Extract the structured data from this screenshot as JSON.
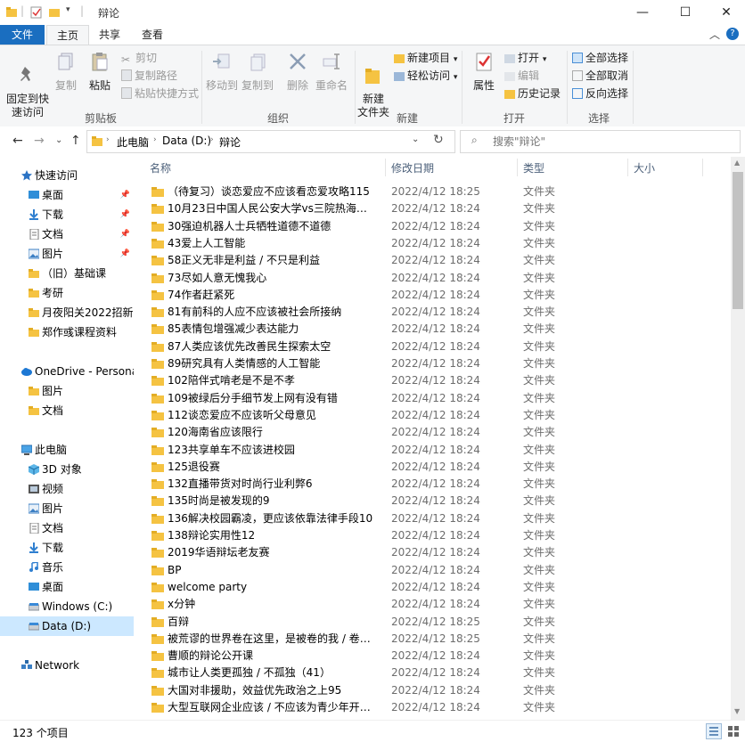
{
  "window": {
    "title": "辩论",
    "minimize": "—",
    "maximize": "☐",
    "close": "✕"
  },
  "tabs": [
    "文件",
    "主页",
    "共享",
    "查看"
  ],
  "ribbon": {
    "clipboard": {
      "pin_quick": "固定到快\n速访问",
      "copy": "复制",
      "paste": "粘贴",
      "cut": "剪切",
      "copy_path": "复制路径",
      "paste_shortcut": "粘贴快捷方式",
      "label": "剪贴板"
    },
    "organize": {
      "move_to": "移动到",
      "copy_to": "复制到",
      "delete": "删除",
      "rename": "重命名",
      "label": "组织"
    },
    "new": {
      "new_folder": "新建\n文件夹",
      "new_item": "新建项目",
      "easy_access": "轻松访问",
      "label": "新建"
    },
    "open": {
      "properties": "属性",
      "open": "打开",
      "edit": "编辑",
      "history": "历史记录",
      "label": "打开"
    },
    "select": {
      "select_all": "全部选择",
      "select_none": "全部取消",
      "invert": "反向选择",
      "label": "选择"
    }
  },
  "address": {
    "crumbs": [
      "此电脑",
      "Data (D:)",
      "辩论"
    ],
    "search_placeholder": "搜索\"辩论\""
  },
  "nav": [
    {
      "label": "快速访问",
      "icon": "star-icon",
      "indent": 0,
      "pin": false
    },
    {
      "label": "桌面",
      "icon": "desktop-icon",
      "indent": 1,
      "pin": true
    },
    {
      "label": "下载",
      "icon": "download-icon",
      "indent": 1,
      "pin": true
    },
    {
      "label": "文档",
      "icon": "document-icon",
      "indent": 1,
      "pin": true
    },
    {
      "label": "图片",
      "icon": "picture-icon",
      "indent": 1,
      "pin": true
    },
    {
      "label": "（旧）基础课",
      "icon": "folder-icon",
      "indent": 1,
      "pin": false
    },
    {
      "label": "考研",
      "icon": "folder-icon",
      "indent": 1,
      "pin": false
    },
    {
      "label": "月夜阳关2022招新",
      "icon": "folder-icon",
      "indent": 1,
      "pin": false
    },
    {
      "label": "郑作彧课程资料",
      "icon": "folder-icon",
      "indent": 1,
      "pin": false
    },
    {
      "label": "",
      "icon": "",
      "indent": 0,
      "pin": false
    },
    {
      "label": "OneDrive - Personal",
      "icon": "cloud-icon",
      "indent": 0,
      "pin": false
    },
    {
      "label": "图片",
      "icon": "folder-icon",
      "indent": 1,
      "pin": false
    },
    {
      "label": "文档",
      "icon": "folder-icon",
      "indent": 1,
      "pin": false
    },
    {
      "label": "",
      "icon": "",
      "indent": 0,
      "pin": false
    },
    {
      "label": "此电脑",
      "icon": "computer-icon",
      "indent": 0,
      "pin": false
    },
    {
      "label": "3D 对象",
      "icon": "cube-icon",
      "indent": 1,
      "pin": false
    },
    {
      "label": "视频",
      "icon": "video-icon",
      "indent": 1,
      "pin": false
    },
    {
      "label": "图片",
      "icon": "picture-icon",
      "indent": 1,
      "pin": false
    },
    {
      "label": "文档",
      "icon": "document-icon",
      "indent": 1,
      "pin": false
    },
    {
      "label": "下载",
      "icon": "download-icon",
      "indent": 1,
      "pin": false
    },
    {
      "label": "音乐",
      "icon": "music-icon",
      "indent": 1,
      "pin": false
    },
    {
      "label": "桌面",
      "icon": "desktop-icon",
      "indent": 1,
      "pin": false
    },
    {
      "label": "Windows (C:)",
      "icon": "drive-icon",
      "indent": 1,
      "pin": false
    },
    {
      "label": "Data (D:)",
      "icon": "drive-icon",
      "indent": 1,
      "pin": false,
      "selected": true
    },
    {
      "label": "",
      "icon": "",
      "indent": 0,
      "pin": false
    },
    {
      "label": "Network",
      "icon": "network-icon",
      "indent": 0,
      "pin": false
    }
  ],
  "columns": [
    "名称",
    "修改日期",
    "类型",
    "大小"
  ],
  "files": [
    {
      "name": "（待复习）谈恋爱应不应该看恋爱攻略115",
      "date": "2022/4/12 18:25",
      "type": "文件夹"
    },
    {
      "name": "10月23日中国人民公安大学vs三院热海联队",
      "date": "2022/4/12 18:24",
      "type": "文件夹"
    },
    {
      "name": "30强迫机器人士兵牺牲道德不道德",
      "date": "2022/4/12 18:24",
      "type": "文件夹"
    },
    {
      "name": "43爱上人工智能",
      "date": "2022/4/12 18:24",
      "type": "文件夹"
    },
    {
      "name": "58正义无非是利益 / 不只是利益",
      "date": "2022/4/12 18:24",
      "type": "文件夹"
    },
    {
      "name": "73尽如人意无愧我心",
      "date": "2022/4/12 18:24",
      "type": "文件夹"
    },
    {
      "name": "74作者赶紧死",
      "date": "2022/4/12 18:24",
      "type": "文件夹"
    },
    {
      "name": "81有前科的人应不应该被社会所接纳",
      "date": "2022/4/12 18:24",
      "type": "文件夹"
    },
    {
      "name": "85表情包增强减少表达能力",
      "date": "2022/4/12 18:24",
      "type": "文件夹"
    },
    {
      "name": "87人类应该优先改善民生探索太空",
      "date": "2022/4/12 18:24",
      "type": "文件夹"
    },
    {
      "name": "89研究具有人类情感的人工智能",
      "date": "2022/4/12 18:24",
      "type": "文件夹"
    },
    {
      "name": "102陪伴式啃老是不是不孝",
      "date": "2022/4/12 18:24",
      "type": "文件夹"
    },
    {
      "name": "109被绿后分手细节发上网有没有错",
      "date": "2022/4/12 18:24",
      "type": "文件夹"
    },
    {
      "name": "112谈恋爱应不应该听父母意见",
      "date": "2022/4/12 18:24",
      "type": "文件夹"
    },
    {
      "name": "120海南省应该限行",
      "date": "2022/4/12 18:24",
      "type": "文件夹"
    },
    {
      "name": "123共享单车不应该进校园",
      "date": "2022/4/12 18:24",
      "type": "文件夹"
    },
    {
      "name": "125退役赛",
      "date": "2022/4/12 18:24",
      "type": "文件夹"
    },
    {
      "name": "132直播带货对时尚行业利弊6",
      "date": "2022/4/12 18:24",
      "type": "文件夹"
    },
    {
      "name": "135时尚是被发现的9",
      "date": "2022/4/12 18:24",
      "type": "文件夹"
    },
    {
      "name": "136解决校园霸凌，更应该依靠法律手段10",
      "date": "2022/4/12 18:24",
      "type": "文件夹"
    },
    {
      "name": "138辩论实用性12",
      "date": "2022/4/12 18:24",
      "type": "文件夹"
    },
    {
      "name": "2019华语辩坛老友赛",
      "date": "2022/4/12 18:24",
      "type": "文件夹"
    },
    {
      "name": "BP",
      "date": "2022/4/12 18:24",
      "type": "文件夹"
    },
    {
      "name": "welcome party",
      "date": "2022/4/12 18:24",
      "type": "文件夹"
    },
    {
      "name": "x分钟",
      "date": "2022/4/12 18:24",
      "type": "文件夹"
    },
    {
      "name": "百辩",
      "date": "2022/4/12 18:25",
      "type": "文件夹"
    },
    {
      "name": "被荒谬的世界卷在这里，是被卷的我 / 卷我的世界",
      "date": "2022/4/12 18:25",
      "type": "文件夹"
    },
    {
      "name": "曹顺的辩论公开课",
      "date": "2022/4/12 18:24",
      "type": "文件夹"
    },
    {
      "name": "城市让人类更孤独 / 不孤独（41）",
      "date": "2022/4/12 18:24",
      "type": "文件夹"
    },
    {
      "name": "大国对非援助，效益优先政治之上95",
      "date": "2022/4/12 18:24",
      "type": "文件夹"
    },
    {
      "name": "大型互联网企业应该 / 不应该为青少年开设防沉迷",
      "date": "2022/4/12 18:24",
      "type": "文件夹"
    }
  ],
  "status": {
    "count": "123 个项目"
  },
  "colors": {
    "file_tab": "#1a6ec0",
    "selection": "#cce8ff",
    "folder": "#f5c342",
    "header_text": "#4c607a"
  }
}
